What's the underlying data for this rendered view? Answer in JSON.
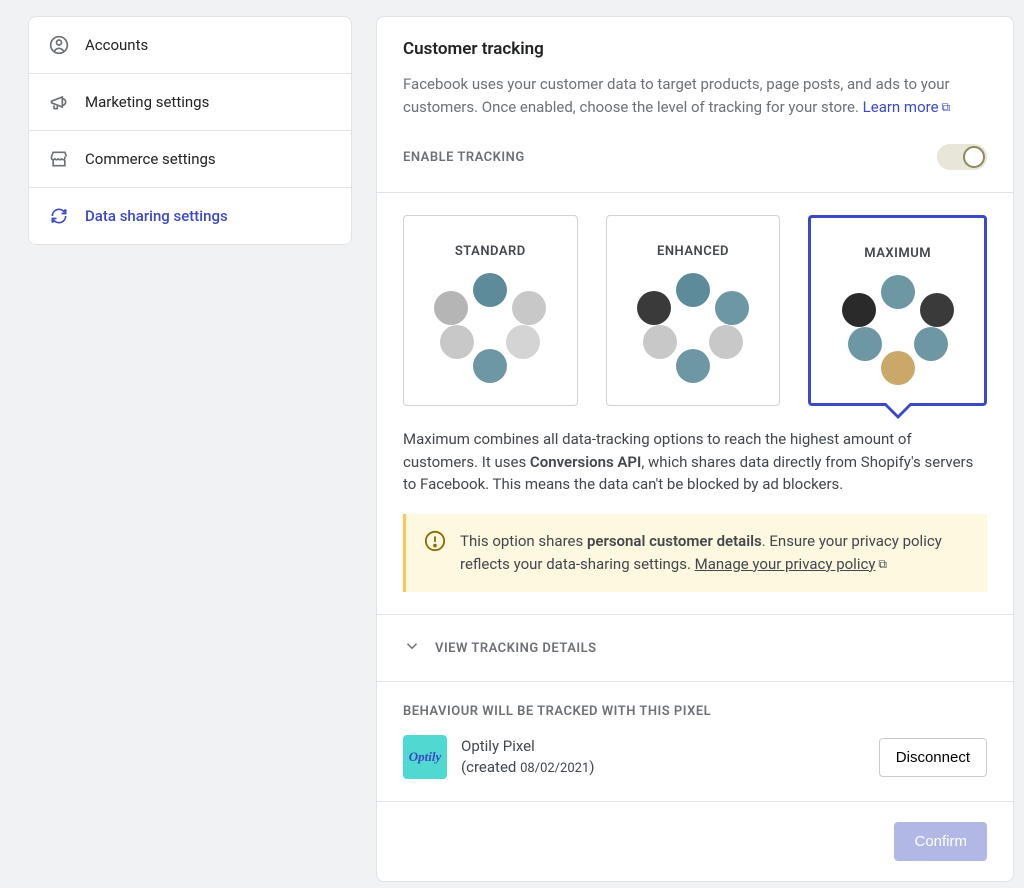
{
  "sidebar": {
    "items": [
      {
        "label": "Accounts"
      },
      {
        "label": "Marketing settings"
      },
      {
        "label": "Commerce settings"
      },
      {
        "label": "Data sharing settings"
      }
    ]
  },
  "header": {
    "title": "Customer tracking",
    "desc_pre": "Facebook uses your customer data to target products, page posts, and ads to your customers. Once enabled, choose the level of tracking for your store. ",
    "learn_more": "Learn more",
    "toggle_label": "ENABLE TRACKING"
  },
  "tracking_cards": {
    "options": [
      {
        "title": "STANDARD"
      },
      {
        "title": "ENHANCED"
      },
      {
        "title": "MAXIMUM"
      }
    ],
    "selected_desc_pre": "Maximum combines all data-tracking options to reach the highest amount of customers. It uses ",
    "selected_desc_bold": "Conversions API",
    "selected_desc_post": ", which shares data directly from Shopify's servers to Facebook. This means the data can't be blocked by ad blockers."
  },
  "warning_banner": {
    "text_pre": "This option shares ",
    "text_bold": "personal customer details",
    "text_post": ". Ensure your privacy policy reflects your data-sharing settings. ",
    "link_label": "Manage your privacy policy"
  },
  "accordion": {
    "label": "VIEW TRACKING DETAILS"
  },
  "pixel": {
    "heading": "BEHAVIOUR WILL BE TRACKED WITH THIS PIXEL",
    "logo_text": "Optily",
    "name": "Optily Pixel",
    "created_prefix": "(created ",
    "created_date": "08/02/2021",
    "created_suffix": ")",
    "disconnect_label": "Disconnect"
  },
  "footer": {
    "confirm_label": "Confirm"
  }
}
